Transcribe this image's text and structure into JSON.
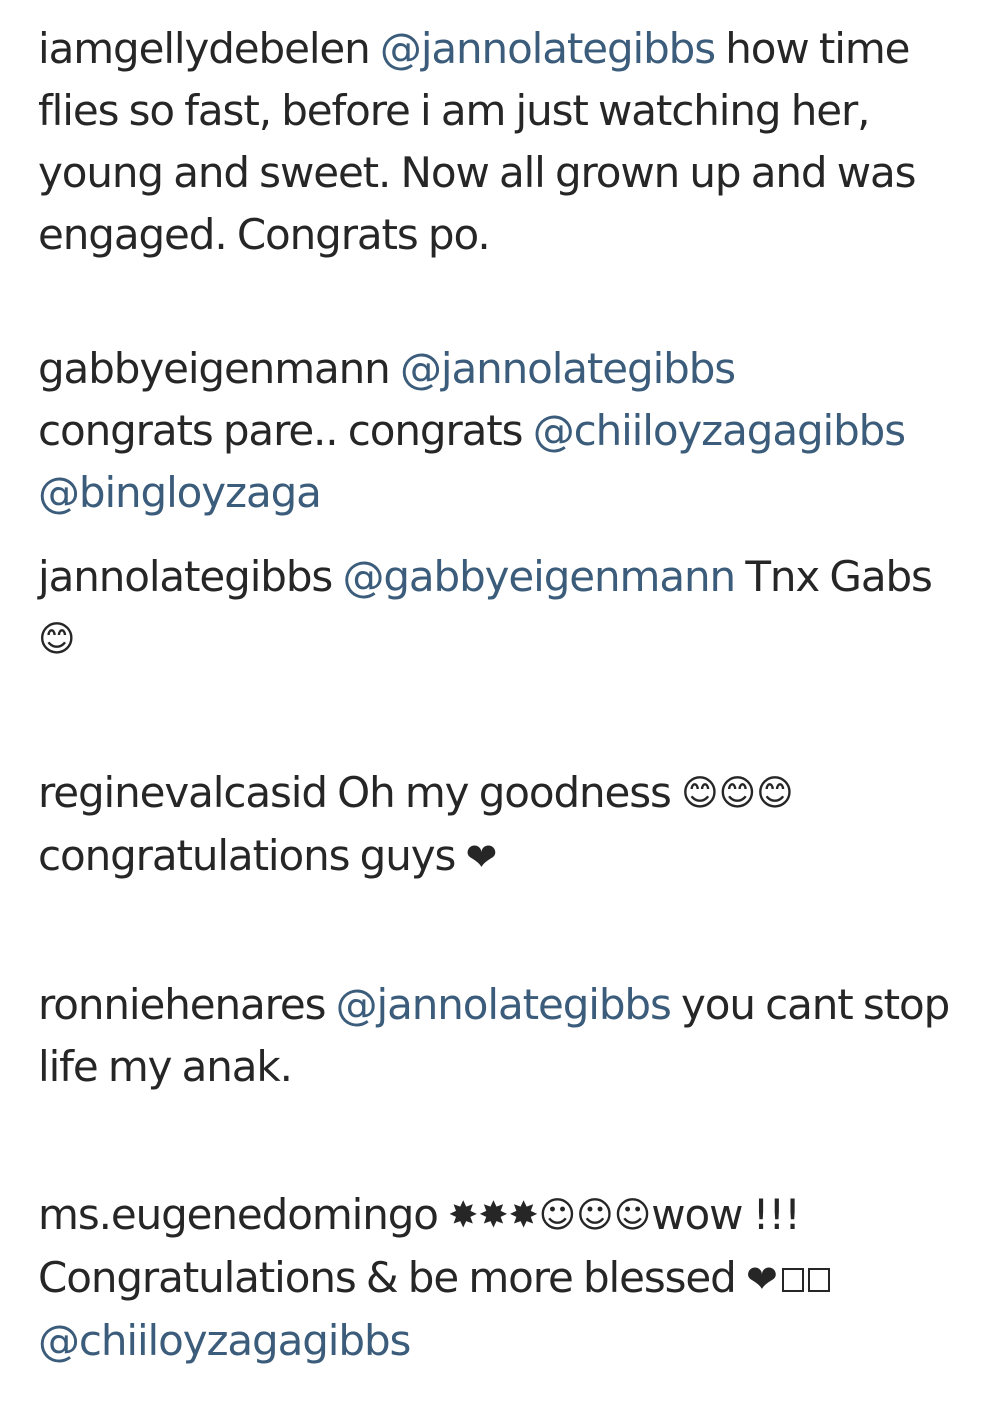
{
  "comments": [
    {
      "username": "iamgellydebelen",
      "mention1": "@jannolategibbs",
      "text1": "how time flies so fast, before i am just watching her, young and sweet. Now all grown up and was engaged. Congrats po."
    },
    {
      "username": "gabbyeigenmann",
      "mention1": "@jannolategibbs",
      "text1": "congrats pare.. congrats",
      "mention2": "@chiiloyzagagibbs",
      "mention3": "@bingloyzaga"
    },
    {
      "username": "jannolategibbs",
      "mention1": "@gabbyeigenmann",
      "text1": "Tnx Gabs",
      "emoji": "😊"
    },
    {
      "username": "reginevalcasid",
      "text1": "Oh my goodness",
      "emojis": "😊😊😊",
      "text2": "congratulations guys",
      "heart": "❤"
    },
    {
      "username": "ronniehenares",
      "mention1": "@jannolategibbs",
      "text1": "you cant stop life my anak."
    },
    {
      "username": "ms.eugenedomingo",
      "stars": "✸✸✸",
      "smiles": "☺☺☺",
      "text1": "wow !!!",
      "text2": "Congratulations & be more blessed",
      "heart": "❤",
      "mention1": "@chiiloyzagagibbs"
    }
  ]
}
